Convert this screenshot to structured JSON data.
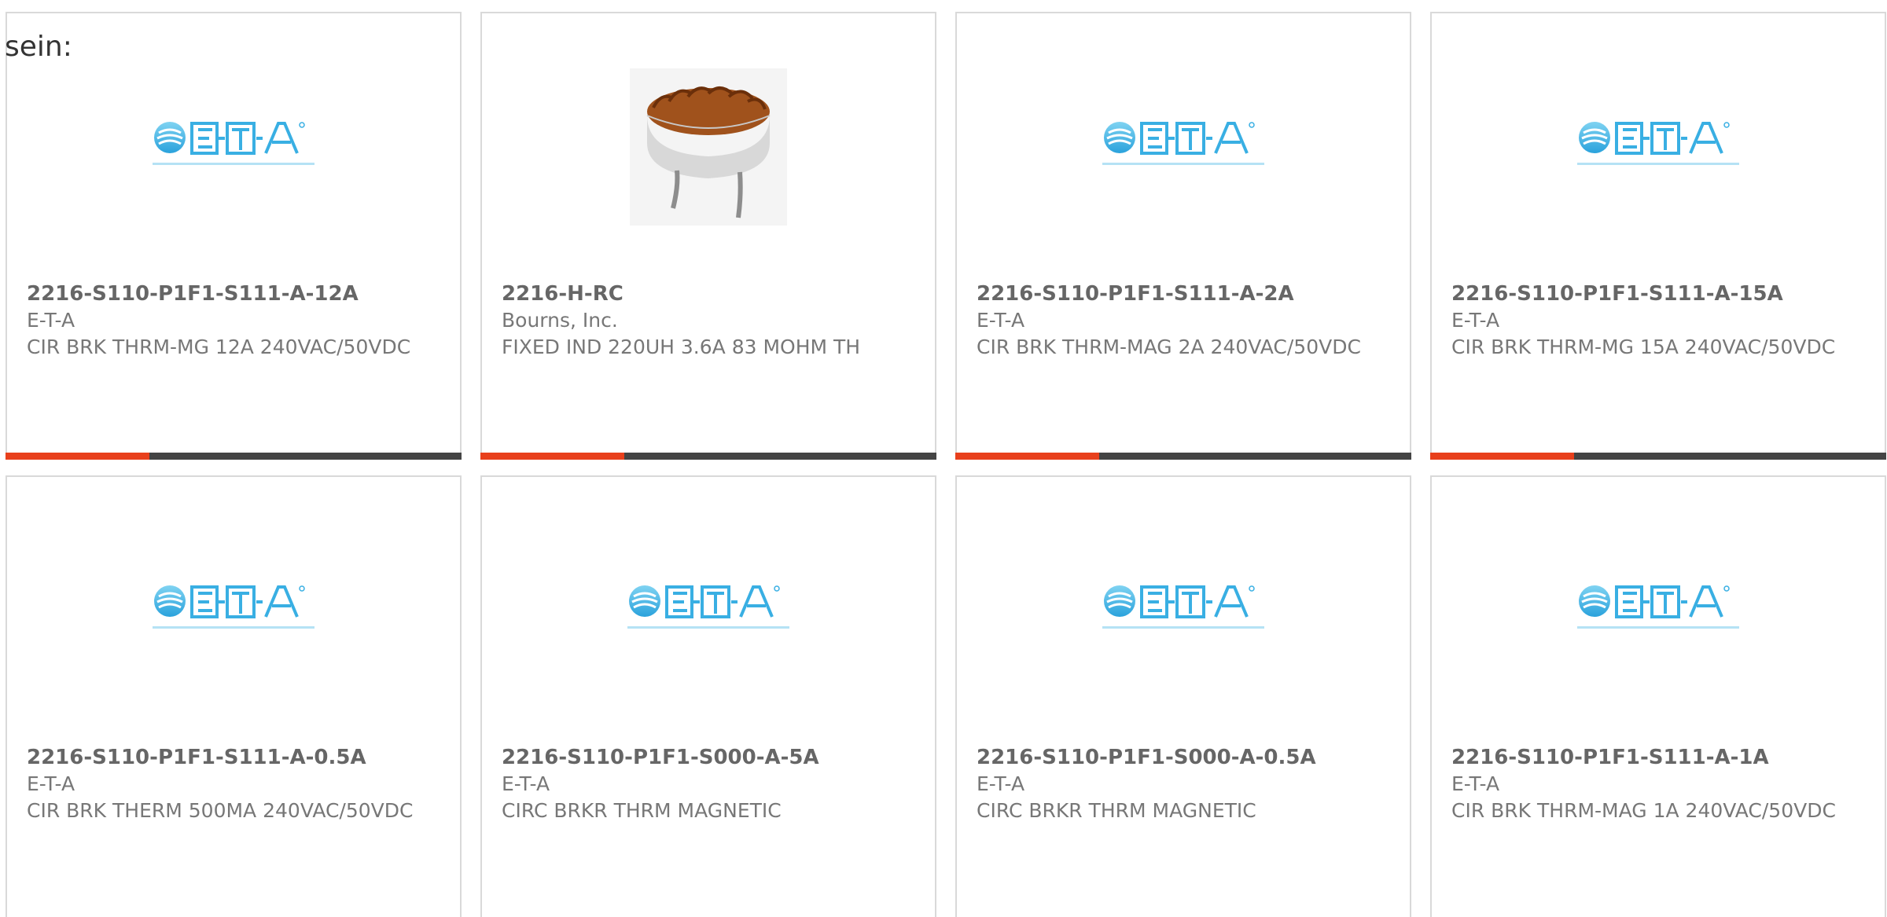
{
  "intro": {
    "text": "sein:"
  },
  "colors": {
    "accent": "#e8401c",
    "bar": "#444444",
    "border": "#d9d9d9",
    "brand_blue": "#3fb4e6"
  },
  "products": [
    {
      "part_number": "2216-S110-P1F1-S111-A-12A",
      "manufacturer": "E-T-A",
      "description": "CIR BRK THRM-MG 12A 240VAC/50VDC",
      "image": "eta-logo"
    },
    {
      "part_number": "2216-H-RC",
      "manufacturer": "Bourns, Inc.",
      "description": "FIXED IND 220UH 3.6A 83 MOHM TH",
      "image": "toroid-inductor"
    },
    {
      "part_number": "2216-S110-P1F1-S111-A-2A",
      "manufacturer": "E-T-A",
      "description": "CIR BRK THRM-MAG 2A 240VAC/50VDC",
      "image": "eta-logo"
    },
    {
      "part_number": "2216-S110-P1F1-S111-A-15A",
      "manufacturer": "E-T-A",
      "description": "CIR BRK THRM-MG 15A 240VAC/50VDC",
      "image": "eta-logo"
    },
    {
      "part_number": "2216-S110-P1F1-S111-A-0.5A",
      "manufacturer": "E-T-A",
      "description": "CIR BRK THERM 500MA 240VAC/50VDC",
      "image": "eta-logo"
    },
    {
      "part_number": "2216-S110-P1F1-S000-A-5A",
      "manufacturer": "E-T-A",
      "description": "CIRC BRKR THRM MAGNETIC",
      "image": "eta-logo"
    },
    {
      "part_number": "2216-S110-P1F1-S000-A-0.5A",
      "manufacturer": "E-T-A",
      "description": "CIRC BRKR THRM MAGNETIC",
      "image": "eta-logo"
    },
    {
      "part_number": "2216-S110-P1F1-S111-A-1A",
      "manufacturer": "E-T-A",
      "description": "CIR BRK THRM-MAG 1A 240VAC/50VDC",
      "image": "eta-logo"
    }
  ]
}
